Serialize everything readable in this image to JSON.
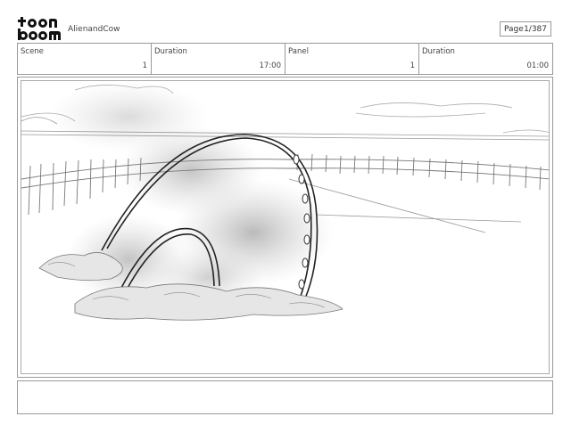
{
  "header": {
    "logo_text": "toon boom",
    "project_name": "AlienandCow",
    "page_label": "Page",
    "page_value": "1/387"
  },
  "info": [
    {
      "label": "Scene",
      "value": "1"
    },
    {
      "label": "Duration",
      "value": "17:00"
    },
    {
      "label": "Panel",
      "value": "1"
    },
    {
      "label": "Duration",
      "value": "01:00"
    }
  ],
  "panel": {
    "sketch": "dome-shaped alien spaceship half buried in a field, smoke around it, fence and horizon in background"
  },
  "notes": {
    "text": ""
  }
}
